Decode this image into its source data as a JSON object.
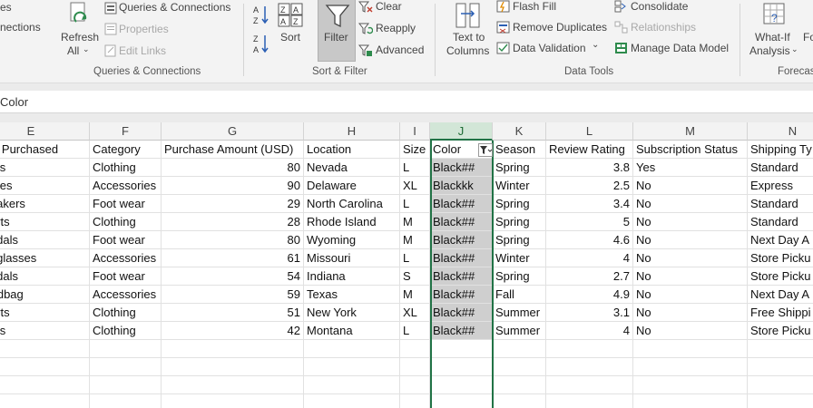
{
  "ribbon": {
    "conn_partial": "es",
    "connections_partial": "nections",
    "refresh_all": [
      "Refresh",
      "All"
    ],
    "queries_connections": "Queries & Connections",
    "properties": "Properties",
    "edit_links": "Edit Links",
    "group_queries": "Queries & Connections",
    "sort": "Sort",
    "filter": "Filter",
    "clear": "Clear",
    "reapply": "Reapply",
    "advanced": "Advanced",
    "group_sort": "Sort & Filter",
    "text_to_columns": [
      "Text to",
      "Columns"
    ],
    "flash_fill": "Flash Fill",
    "remove_duplicates": "Remove Duplicates",
    "data_validation": "Data Validation",
    "consolidate": "Consolidate",
    "relationships": "Relationships",
    "manage_data_model": "Manage Data Model",
    "group_data_tools": "Data Tools",
    "what_if": [
      "What-If",
      "Analysis"
    ],
    "forecast_partial": "Fo",
    "group_forecast": "Forecas"
  },
  "formula_bar": {
    "content": "Color"
  },
  "columns": [
    "E",
    "F",
    "G",
    "H",
    "I",
    "J",
    "K",
    "L",
    "M",
    "N"
  ],
  "selected_column": "J",
  "headers": [
    "Item Purchased",
    "Category",
    "Purchase Amount (USD)",
    "Location",
    "Size",
    "Color",
    "Season",
    "Review Rating",
    "Subscription Status",
    "Shipping Ty"
  ],
  "rows": [
    [
      "Pants",
      "Clothing",
      "80",
      "Nevada",
      "L",
      "Black##",
      "Spring",
      "3.8",
      "Yes",
      "Standard"
    ],
    [
      "Gloves",
      "Accessories",
      "90",
      "Delaware",
      "XL",
      "Blackkk",
      "Winter",
      "2.5",
      "No",
      "Express"
    ],
    [
      "Sneakers",
      "Foot wear",
      "29",
      "North Carolina",
      "L",
      "Black##",
      "Spring",
      "3.4",
      "No",
      "Standard"
    ],
    [
      "Shorts",
      "Clothing",
      "28",
      "Rhode Island",
      "M",
      "Black##",
      "Spring",
      "5",
      "No",
      "Standard"
    ],
    [
      "Sandals",
      "Foot wear",
      "80",
      "Wyoming",
      "M",
      "Black##",
      "Spring",
      "4.6",
      "No",
      "Next Day A"
    ],
    [
      "Sunglasses",
      "Accessories",
      "61",
      "Missouri",
      "L",
      "Black##",
      "Winter",
      "4",
      "No",
      "Store Picku"
    ],
    [
      "Sandals",
      "Foot wear",
      "54",
      "Indiana",
      "S",
      "Black##",
      "Spring",
      "2.7",
      "No",
      "Store Picku"
    ],
    [
      "Handbag",
      "Accessories",
      "59",
      "Texas",
      "M",
      "Black##",
      "Fall",
      "4.9",
      "No",
      "Next Day A"
    ],
    [
      "Shorts",
      "Clothing",
      "51",
      "New York",
      "XL",
      "Black##",
      "Summer",
      "3.1",
      "No",
      "Free Shippi"
    ],
    [
      "Pants",
      "Clothing",
      "42",
      "Montana",
      "L",
      "Black##",
      "Summer",
      "4",
      "No",
      "Store Picku"
    ]
  ],
  "colors": {
    "accent": "#217346",
    "selected_fill": "#cfcfcf"
  }
}
